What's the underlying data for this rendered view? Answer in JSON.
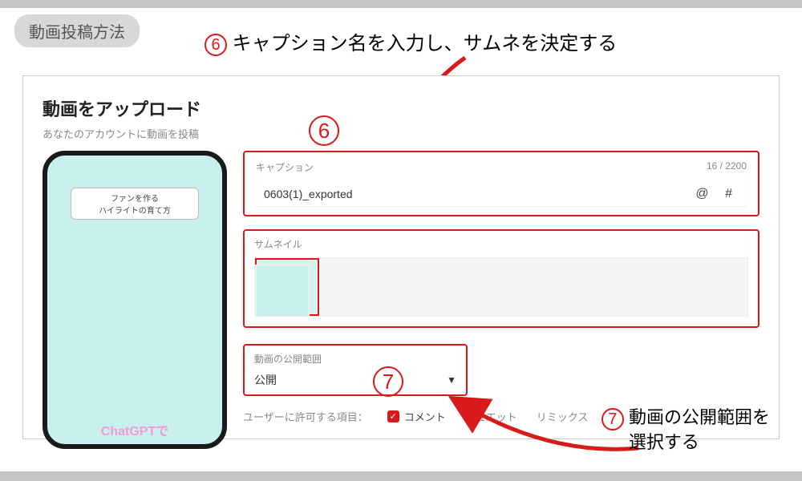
{
  "header": {
    "pill": "動画投稿方法"
  },
  "callouts": {
    "top_marker": "6",
    "top_text": "キャプション名を入力し、サムネを決定する",
    "right_marker": "7",
    "right_line1": "動画の公開範囲を",
    "right_line2": "選択する"
  },
  "panel": {
    "title": "動画をアップロード",
    "subtitle": "あなたのアカウントに動画を投稿",
    "phone_banner_line1": "ファンを作る",
    "phone_banner_line2": "ハイライトの育て方",
    "phone_bottom": "ChatGPTで"
  },
  "caption": {
    "label": "キャプション",
    "counter": "16 / 2200",
    "value": "0603(1)_exported",
    "mentions": "@  #",
    "marker": "6"
  },
  "thumbnail": {
    "label": "サムネイル"
  },
  "privacy": {
    "label": "動画の公開範囲",
    "value": "公開",
    "marker": "7"
  },
  "permissions": {
    "label": "ユーザーに許可する項目：",
    "comment": "コメント",
    "duet": "デュエット",
    "remix": "リミックス"
  }
}
